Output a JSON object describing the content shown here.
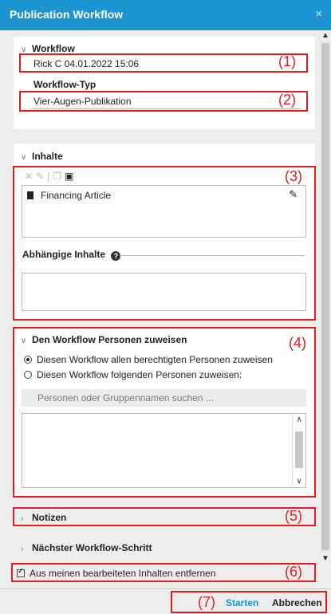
{
  "window": {
    "title": "Publication Workflow",
    "close_glyph": "×"
  },
  "workflow": {
    "section_label": "Workflow",
    "name_value": "Rick C 04.01.2022 15:06",
    "type_label": "Workflow-Typ",
    "type_value": "Vier-Augen-Publikation"
  },
  "inhalte": {
    "section_label": "Inhalte",
    "items": [
      {
        "label": "Financing Article"
      }
    ],
    "dependent_label": "Abhängige Inhalte",
    "dependent_placeholder": ""
  },
  "assign": {
    "section_label": "Den Workflow Personen zuweisen",
    "option_all": "Diesen Workflow allen berechtigten Personen zuweisen",
    "option_specific": "Diesen Workflow folgenden Personen zuweisen:",
    "selected": "all",
    "search_placeholder": "Personen oder Gruppennamen suchen ..."
  },
  "notizen": {
    "section_label": "Notizen"
  },
  "next_step": {
    "section_label": "Nächster Workflow-Schritt"
  },
  "remove_option": {
    "label": "Aus meinen bearbeiteten Inhalten entfernen",
    "checked": true
  },
  "buttons": {
    "start": "Starten",
    "cancel": "Abbrechen"
  },
  "annotations": [
    "(1)",
    "(2)",
    "(3)",
    "(4)",
    "(5)",
    "(6)",
    "(7)"
  ],
  "colors": {
    "accent": "#1c94d2",
    "annotation": "#e02020"
  }
}
